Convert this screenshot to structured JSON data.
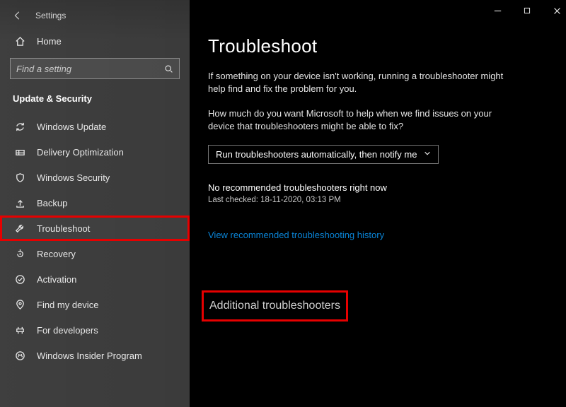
{
  "app_title": "Settings",
  "home_label": "Home",
  "search_placeholder": "Find a setting",
  "section_title": "Update & Security",
  "sidebar": {
    "items": [
      {
        "label": "Windows Update",
        "icon": "sync-icon"
      },
      {
        "label": "Delivery Optimization",
        "icon": "delivery-icon"
      },
      {
        "label": "Windows Security",
        "icon": "shield-icon"
      },
      {
        "label": "Backup",
        "icon": "backup-icon"
      },
      {
        "label": "Troubleshoot",
        "icon": "wrench-icon"
      },
      {
        "label": "Recovery",
        "icon": "recovery-icon"
      },
      {
        "label": "Activation",
        "icon": "check-circle-icon"
      },
      {
        "label": "Find my device",
        "icon": "location-icon"
      },
      {
        "label": "For developers",
        "icon": "developer-icon"
      },
      {
        "label": "Windows Insider Program",
        "icon": "insider-icon"
      }
    ]
  },
  "main": {
    "title": "Troubleshoot",
    "intro": "If something on your device isn't working, running a troubleshooter might help find and fix the problem for you.",
    "prompt": "How much do you want Microsoft to help when we find issues on your device that troubleshooters might be able to fix?",
    "dropdown_value": "Run troubleshooters automatically, then notify me",
    "status": "No recommended troubleshooters right now",
    "last_checked": "Last checked: 18-11-2020, 03:13 PM",
    "link": "View recommended troubleshooting history",
    "additional": "Additional troubleshooters"
  },
  "highlight_index": 4
}
